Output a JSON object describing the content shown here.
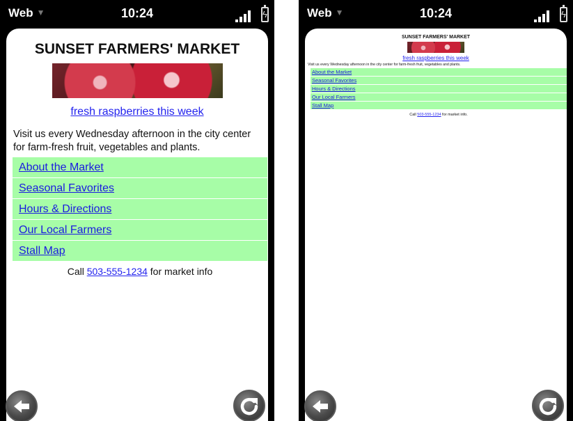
{
  "status": {
    "app_menu_label": "Web",
    "time": "10:24"
  },
  "page": {
    "title": "SUNSET FARMERS' MARKET",
    "caption_link": "fresh raspberries this week",
    "intro": "Visit us every Wednesday afternoon in the city center for farm-fresh fruit, vegetables and plants.",
    "nav": [
      {
        "label": "About the Market"
      },
      {
        "label": "Seasonal Favorites"
      },
      {
        "label": "Hours & Directions"
      },
      {
        "label": "Our Local Farmers"
      },
      {
        "label": "Stall Map"
      }
    ],
    "footer": {
      "prefix": "Call ",
      "phone": "503-555-1234",
      "suffix": " for market info"
    }
  },
  "zoomed_page": {
    "footer_suffix": " for market info."
  },
  "colors": {
    "nav_background": "#a7fda7",
    "link": "#1a1ae0",
    "screen": "#ffffff",
    "chrome": "#000000"
  }
}
